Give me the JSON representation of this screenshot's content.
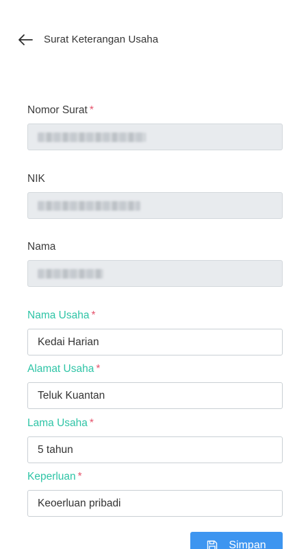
{
  "header": {
    "title": "Surat Keterangan Usaha",
    "back_icon": "arrow-left-icon"
  },
  "form": {
    "nomor_surat": {
      "label": "Nomor Surat",
      "required": "*",
      "value": "",
      "redacted": true,
      "disabled": true
    },
    "nik": {
      "label": "NIK",
      "value": "",
      "redacted": true,
      "disabled": true
    },
    "nama": {
      "label": "Nama",
      "value": "",
      "redacted": true,
      "disabled": true
    },
    "nama_usaha": {
      "label": "Nama Usaha",
      "required": "*",
      "value": "Kedai Harian"
    },
    "alamat_usaha": {
      "label": "Alamat Usaha",
      "required": "*",
      "value": "Teluk Kuantan"
    },
    "lama_usaha": {
      "label": "Lama Usaha",
      "required": "*",
      "value": "5 tahun"
    },
    "keperluan": {
      "label": "Keperluan",
      "required": "*",
      "value": "Keoerluan pribadi"
    }
  },
  "actions": {
    "save_label": "Simpan",
    "save_icon": "floppy-disk-icon"
  },
  "colors": {
    "accent_label": "#2ec4a6",
    "required": "#e5536c",
    "button": "#3d95f0",
    "disabled_bg": "#e8ebee"
  }
}
